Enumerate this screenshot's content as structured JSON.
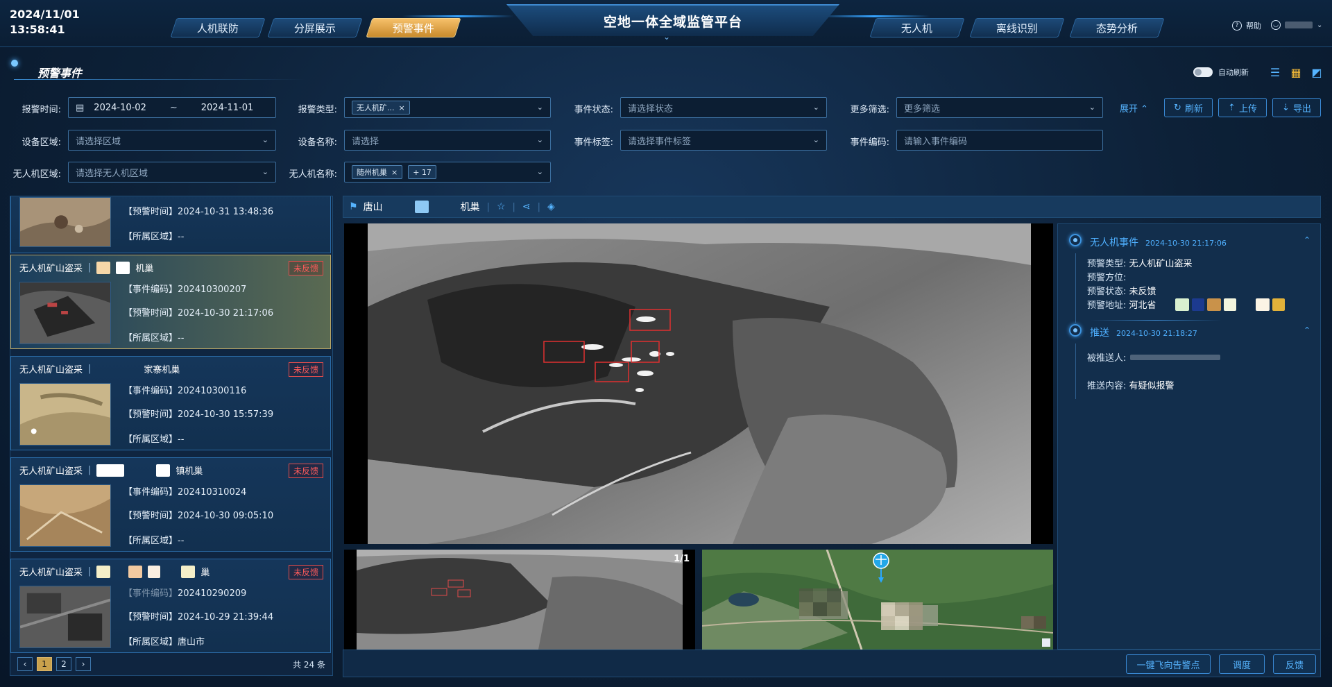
{
  "header": {
    "date": "2024/11/01",
    "time": "13:58:41",
    "title": "空地一体全域监管平台",
    "nav_left": [
      {
        "label": "人机联防",
        "active": false
      },
      {
        "label": "分屏展示",
        "active": false
      },
      {
        "label": "预警事件",
        "active": true
      }
    ],
    "nav_right": [
      {
        "label": "无人机",
        "active": false
      },
      {
        "label": "离线识别",
        "active": false
      },
      {
        "label": "态势分析",
        "active": false
      }
    ],
    "help_label": "帮助"
  },
  "page": {
    "title": "预警事件",
    "auto_refresh_label": "自动刷新"
  },
  "filters": {
    "alarm_time_label": "报警时间:",
    "date_start": "2024-10-02",
    "date_sep": "~",
    "date_end": "2024-11-01",
    "alarm_type_label": "报警类型:",
    "alarm_type_chip": "无人机矿...",
    "event_status_label": "事件状态:",
    "event_status_placeholder": "请选择状态",
    "more_filter_label": "更多筛选:",
    "more_filter_placeholder": "更多筛选",
    "device_area_label": "设备区域:",
    "device_area_placeholder": "请选择区域",
    "device_name_label": "设备名称:",
    "device_name_placeholder": "请选择",
    "event_tag_label": "事件标签:",
    "event_tag_placeholder": "请选择事件标签",
    "event_code_label": "事件编码:",
    "event_code_placeholder": "请输入事件编码",
    "uav_area_label": "无人机区域:",
    "uav_area_placeholder": "请选择无人机区域",
    "uav_name_label": "无人机名称:",
    "uav_name_chip": "随州机巢",
    "uav_name_more": "+ 17",
    "expand_label": "展开",
    "refresh_label": "刷新",
    "upload_label": "上传",
    "export_label": "导出"
  },
  "list": {
    "items": [
      {
        "title": "",
        "station": "",
        "status": "",
        "code": "",
        "time": "2024-10-31 13:48:36",
        "area": "--",
        "code_label": "",
        "time_label": "【预警时间】",
        "area_label": "【所属区域】"
      },
      {
        "title": "无人机矿山盗采",
        "station": "机巢",
        "status": "未反馈",
        "code": "202410300207",
        "time": "2024-10-30 21:17:06",
        "area": "--",
        "code_label": "【事件编码】",
        "time_label": "【预警时间】",
        "area_label": "【所属区域】"
      },
      {
        "title": "无人机矿山盗采",
        "station": "家寨机巢",
        "status": "未反馈",
        "code": "202410300116",
        "time": "2024-10-30 15:57:39",
        "area": "--",
        "code_label": "【事件编码】",
        "time_label": "【预警时间】",
        "area_label": "【所属区域】"
      },
      {
        "title": "无人机矿山盗采",
        "station": "镇机巢",
        "status": "未反馈",
        "code": "202410310024",
        "time": "2024-10-30 09:05:10",
        "area": "--",
        "code_label": "【事件编码】",
        "time_label": "【预警时间】",
        "area_label": "【所属区域】"
      },
      {
        "title": "无人机矿山盗采",
        "station": "巢",
        "status": "未反馈",
        "code": "202410290209",
        "time": "2024-10-29 21:39:44",
        "area": "唐山市",
        "code_label": "【事件编码】",
        "time_label": "【预警时间】",
        "area_label": "【所属区域】"
      }
    ],
    "pages": [
      "1",
      "2"
    ],
    "prev": "‹",
    "next": "›",
    "total": "共 24 条"
  },
  "detail": {
    "title_prefix": "唐山",
    "title_suffix": "机巢",
    "page_indicator": "1/1",
    "event_section": {
      "title": "无人机事件",
      "time": "2024-10-30 21:17:06",
      "type_label": "预警类型:",
      "type_value": "无人机矿山盗采",
      "direction_label": "预警方位:",
      "direction_value": "",
      "status_label": "预警状态:",
      "status_value": "未反馈",
      "address_label": "预警地址:",
      "address_value": "河北省"
    },
    "push_section": {
      "title": "推送",
      "time": "2024-10-30 21:18:27",
      "receiver_label": "被推送人:",
      "content_label": "推送内容:",
      "content_value": "有疑似报警"
    },
    "actions": {
      "fly_label": "一键飞向告警点",
      "dispatch_label": "调度",
      "feedback_label": "反馈"
    }
  },
  "colors": {
    "accent": "#56b4ff",
    "alert": "#ff5b5b",
    "active_tab": "#e0a849"
  }
}
